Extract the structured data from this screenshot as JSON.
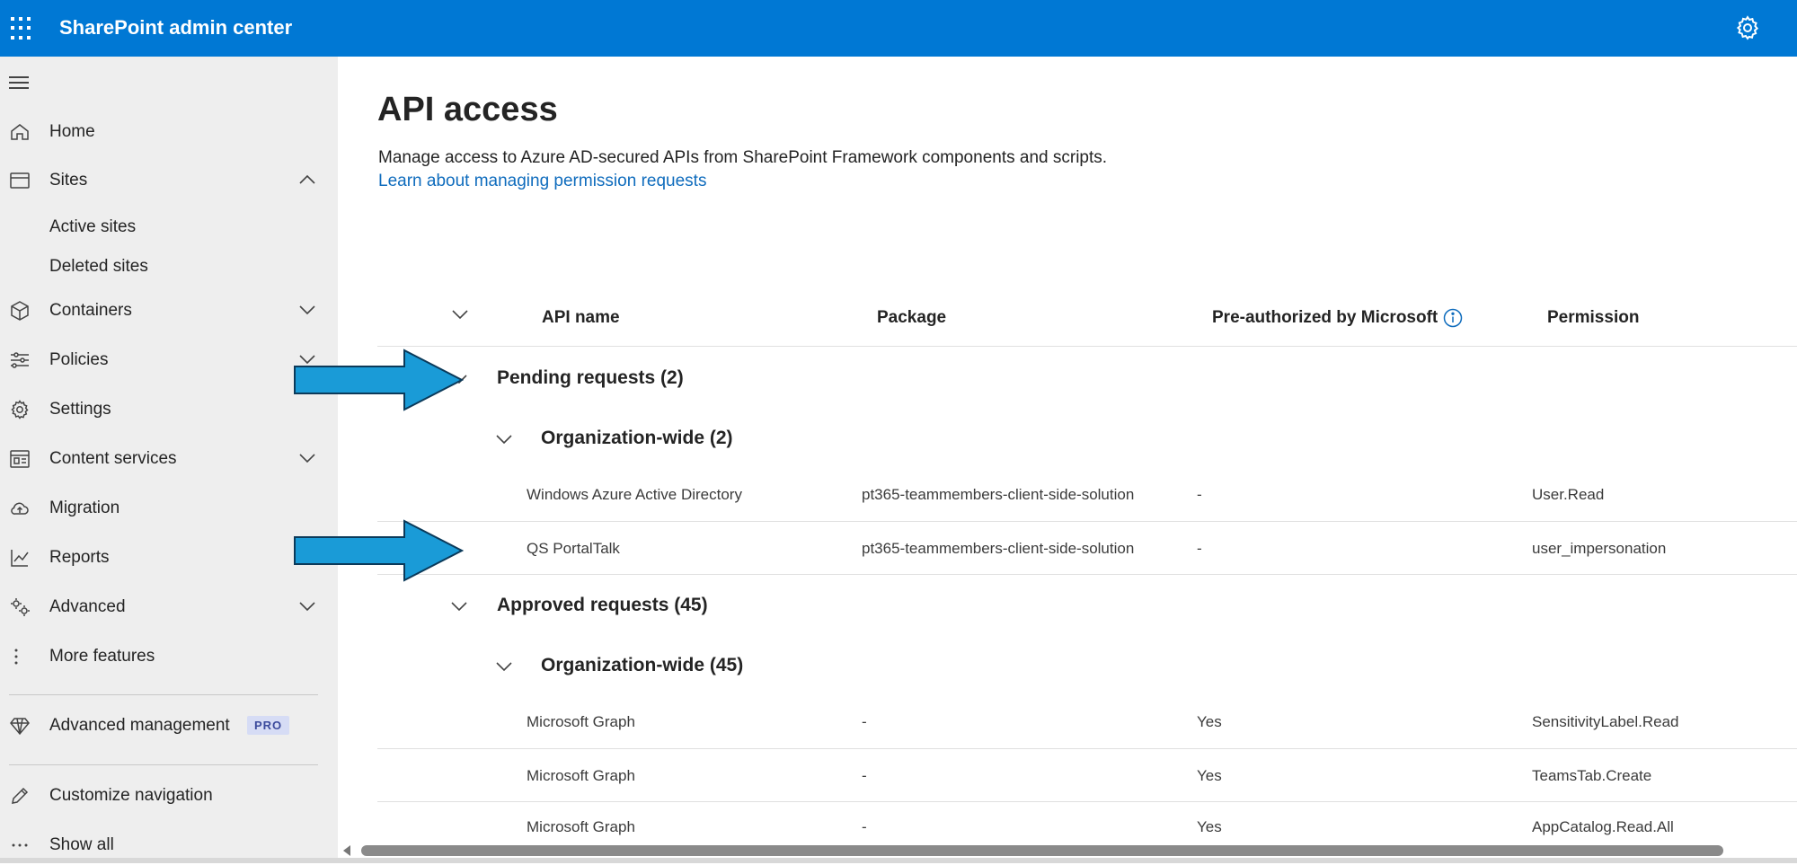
{
  "header": {
    "app_title": "SharePoint admin center",
    "brand_color": "#0078d4"
  },
  "sidebar": {
    "items": [
      {
        "label": "Home",
        "icon": "home-icon"
      },
      {
        "label": "Sites",
        "icon": "sites-icon",
        "expanded": true
      },
      {
        "label": "Active sites"
      },
      {
        "label": "Deleted sites"
      },
      {
        "label": "Containers",
        "icon": "cube-icon"
      },
      {
        "label": "Policies",
        "icon": "sliders-icon"
      },
      {
        "label": "Settings",
        "icon": "gear-icon"
      },
      {
        "label": "Content services",
        "icon": "content-services-icon"
      },
      {
        "label": "Migration",
        "icon": "cloud-upload-icon"
      },
      {
        "label": "Reports",
        "icon": "chart-icon"
      },
      {
        "label": "Advanced",
        "icon": "advanced-gear-icon"
      },
      {
        "label": "More features",
        "icon": "more-vertical-icon"
      },
      {
        "label": "Advanced management",
        "icon": "diamond-icon",
        "badge": "PRO"
      },
      {
        "label": "Customize navigation",
        "icon": "pencil-icon"
      },
      {
        "label": "Show all",
        "icon": "ellipsis-icon"
      }
    ]
  },
  "page": {
    "title": "API access",
    "description": "Manage access to Azure AD-secured APIs from SharePoint Framework components and scripts.",
    "link": "Learn about managing permission requests"
  },
  "table": {
    "columns": [
      "API name",
      "Package",
      "Pre-authorized by Microsoft",
      "Permission"
    ],
    "groups": [
      {
        "title": "Pending requests (2)",
        "subgroup": "Organization-wide (2)",
        "rows": [
          [
            "Windows Azure Active Directory",
            "pt365-teammembers-client-side-solution",
            "-",
            "User.Read"
          ],
          [
            "QS PortalTalk",
            "pt365-teammembers-client-side-solution",
            "-",
            "user_impersonation"
          ]
        ]
      },
      {
        "title": "Approved requests (45)",
        "subgroup": "Organization-wide (45)",
        "rows": [
          [
            "Microsoft Graph",
            "-",
            "Yes",
            "SensitivityLabel.Read"
          ],
          [
            "Microsoft Graph",
            "-",
            "Yes",
            "TeamsTab.Create"
          ],
          [
            "Microsoft Graph",
            "-",
            "Yes",
            "AppCatalog.Read.All"
          ]
        ]
      }
    ]
  },
  "annotation_color": "#1a9bd7"
}
